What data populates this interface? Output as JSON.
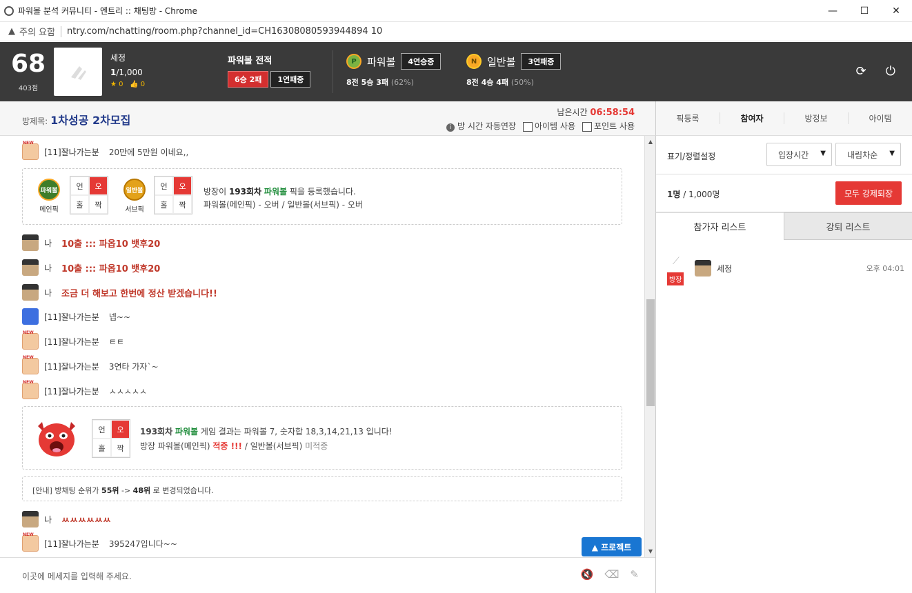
{
  "window": {
    "title": "파워볼 분석 커뮤니티 - 엔트리 :: 채팅방 - Chrome",
    "security_label": "주의 요함",
    "url": "ntry.com/nchatting/room.php?channel_id=CH16308080593944894 10"
  },
  "user": {
    "level": "68",
    "points": "403점",
    "name": "세정",
    "count_current": "1",
    "count_total": "/1,000",
    "stars": "0",
    "likes": "0"
  },
  "record": {
    "title": "파워볼 전적",
    "win_loss": "6승 2패",
    "streak": "1연패중"
  },
  "powerball": {
    "icon": "P",
    "name": "파워볼",
    "streak": "4연승중",
    "stat_prefix": "8전 5승 3패",
    "pct": "(62%)"
  },
  "normalball": {
    "icon": "N",
    "name": "일반볼",
    "streak": "3연패중",
    "stat_prefix": "8전 4승 4패",
    "pct": "(50%)"
  },
  "room": {
    "label": "방제목:",
    "title": "1차성공 2차모집",
    "timer_label": "남은시간",
    "timer": "06:58:54",
    "auto_extend": "방 시간 자동연장",
    "item_use": "아이템 사용",
    "point_use": "포인트 사용"
  },
  "rtabs": [
    "픽등록",
    "참여자",
    "방정보",
    "아이템"
  ],
  "messages": [
    {
      "nick": "[11]잘나가는분",
      "text": "20만에 5만원 이네요,,"
    },
    {
      "nick": "나",
      "text": "10출 ::: 파옵10 뱃후20"
    },
    {
      "nick": "나",
      "text": "10출 ::: 파옵10 뱃후20"
    },
    {
      "nick": "나",
      "text": "조금 더 해보고 한번에 정산 받겠습니다!!"
    },
    {
      "nick": "[11]잘나가는분",
      "text": "넵~~"
    },
    {
      "nick": "[11]잘나가는분",
      "text": "ㅌㅌ"
    },
    {
      "nick": "[11]잘나가는분",
      "text": "3연타 가자`~"
    },
    {
      "nick": "[11]잘나가는분",
      "text": "ㅅㅅㅅㅅㅅ"
    },
    {
      "nick": "나",
      "text": "ㅆㅆㅆㅆㅆㅆ"
    },
    {
      "nick": "[11]잘나가는분",
      "text": "395247입니다~~"
    }
  ],
  "pick": {
    "main_ball": "파워볼",
    "main_label": "메인픽",
    "sub_ball": "일반볼",
    "sub_label": "서브픽",
    "cells": [
      "언",
      "오",
      "홀",
      "짝"
    ],
    "line1_pre": "방장이 ",
    "line1_round": "193회차",
    "line1_ball": "파워볼",
    "line1_post": " 픽을 등록했습니다.",
    "line2": "파워볼(메인픽) - 오버 / 일반볼(서브픽) - 오버"
  },
  "result": {
    "round": "193회차",
    "ball": "파워볼",
    "line1_post": " 게임 결과는 파워볼 7, 숫자합 18,3,14,21,13 입니다!",
    "line2_pre": "방장 파워볼(메인픽) ",
    "hit": "적중 !!!",
    "line2_mid": " / 일반볼(서브픽) ",
    "miss": "미적중"
  },
  "notice": {
    "pre": "[안내] 방채팅 순위가 ",
    "from": "55위",
    "arrow": " -> ",
    "to": "48위",
    "post": " 로 변경되었습니다."
  },
  "project_btn": "▲ 프로젝트",
  "input": {
    "placeholder": "이곳에 메세지를 입력해 주세요."
  },
  "panel": {
    "sort_label": "표기/정렬설정",
    "sort1": "입장시간",
    "sort2": "내림차순",
    "count_cur": "1명",
    "count_total": " / 1,000명",
    "kick_btn": "모두 강제퇴장",
    "tab_on": "참가자 리스트",
    "tab_off": "강퇴 리스트",
    "member": {
      "badge": "방장",
      "name": "세정",
      "time": "오후 04:01"
    }
  }
}
